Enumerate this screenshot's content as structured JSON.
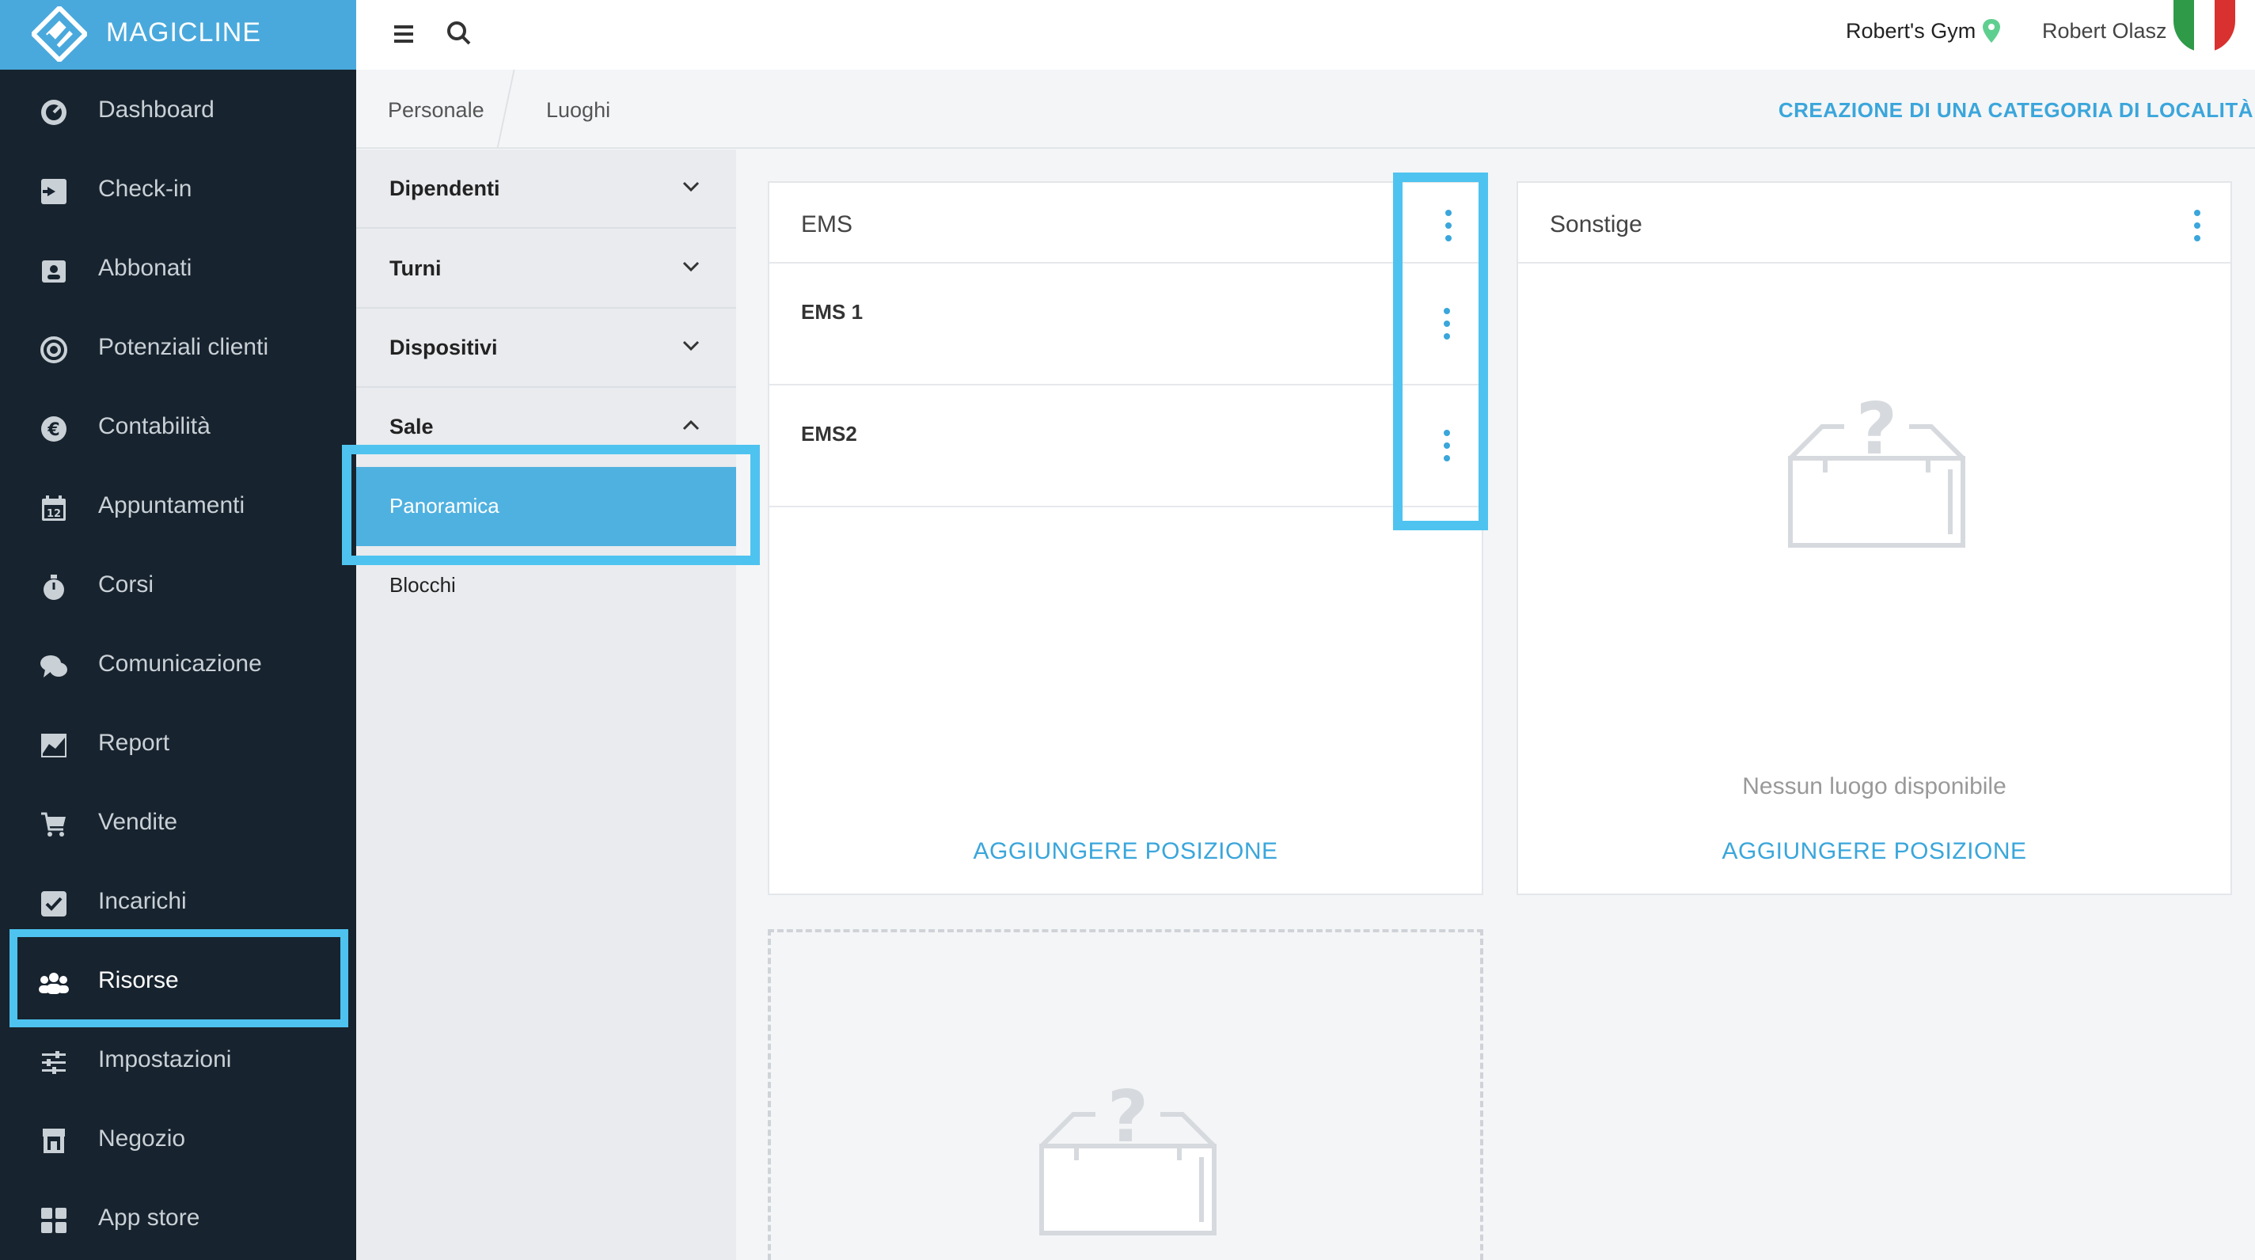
{
  "brand": {
    "name": "MAGICLINE",
    "color": "#4aa9dc"
  },
  "sidebar": {
    "items": [
      {
        "label": "Dashboard",
        "icon": "dashboard-icon"
      },
      {
        "label": "Check-in",
        "icon": "check-in-icon"
      },
      {
        "label": "Abbonati",
        "icon": "members-icon"
      },
      {
        "label": "Potenziali clienti",
        "icon": "leads-icon"
      },
      {
        "label": "Contabilità",
        "icon": "euro-icon"
      },
      {
        "label": "Appuntamenti",
        "icon": "calendar-icon"
      },
      {
        "label": "Corsi",
        "icon": "stopwatch-icon"
      },
      {
        "label": "Comunicazione",
        "icon": "chat-icon"
      },
      {
        "label": "Report",
        "icon": "report-icon"
      },
      {
        "label": "Vendite",
        "icon": "cart-icon"
      },
      {
        "label": "Incarichi",
        "icon": "checkbox-icon"
      },
      {
        "label": "Risorse",
        "icon": "people-icon",
        "active": true
      },
      {
        "label": "Impostazioni",
        "icon": "sliders-icon"
      },
      {
        "label": "Negozio",
        "icon": "shop-icon"
      },
      {
        "label": "App store",
        "icon": "grid-icon"
      }
    ]
  },
  "header": {
    "gym_name": "Robert's Gym",
    "user_name": "Robert Olasz"
  },
  "breadcrumb": {
    "items": [
      "Personale",
      "Luoghi"
    ],
    "action": "CREAZIONE DI UNA CATEGORIA DI LOCALITÀ"
  },
  "subnav": {
    "sections": [
      {
        "label": "Dipendenti",
        "expanded": false
      },
      {
        "label": "Turni",
        "expanded": false
      },
      {
        "label": "Dispositivi",
        "expanded": false
      },
      {
        "label": "Sale",
        "expanded": true
      }
    ],
    "children": [
      {
        "label": "Panoramica",
        "selected": true
      },
      {
        "label": "Blocchi",
        "selected": false
      }
    ]
  },
  "cards": [
    {
      "title": "EMS",
      "rows": [
        "EMS 1",
        "EMS2"
      ],
      "add_label": "AGGIUNGERE POSIZIONE"
    },
    {
      "title": "Sonstige",
      "empty_text": "Nessun luogo disponibile",
      "add_label": "AGGIUNGERE POSIZIONE"
    }
  ],
  "colors": {
    "accent": "#3aa6db",
    "highlight": "#4ec3f0",
    "sidebar_bg": "#17232e"
  }
}
